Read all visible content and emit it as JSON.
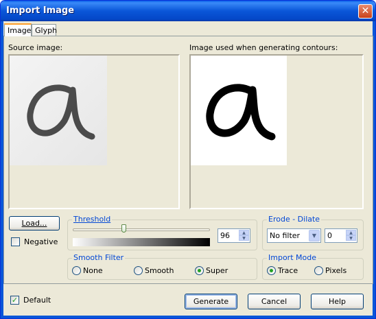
{
  "window": {
    "title": "Import Image",
    "close_glyph": "✕"
  },
  "tabs": [
    {
      "label": "Image",
      "active": true
    },
    {
      "label": "Glyph",
      "active": false
    }
  ],
  "source": {
    "label": "Source image:",
    "glyph": "a"
  },
  "contour": {
    "label": "Image used when generating contours:",
    "glyph": "a"
  },
  "load_button": "Load...",
  "negative": {
    "label": "Negative",
    "checked": false
  },
  "threshold": {
    "title": "Threshold",
    "value": "96",
    "slider_fraction": 0.37
  },
  "erode": {
    "title": "Erode - Dilate",
    "filter_value": "No filter",
    "spin_value": "0"
  },
  "smooth_filter": {
    "title": "Smooth Filter",
    "options": [
      {
        "label": "None",
        "selected": false
      },
      {
        "label": "Smooth",
        "selected": false
      },
      {
        "label": "Super",
        "selected": true
      }
    ]
  },
  "import_mode": {
    "title": "Import Mode",
    "options": [
      {
        "label": "Trace",
        "selected": true
      },
      {
        "label": "Pixels",
        "selected": false
      }
    ]
  },
  "default_check": {
    "label": "Default",
    "checked": true
  },
  "footer": {
    "generate": "Generate",
    "cancel": "Cancel",
    "help": "Help"
  },
  "colors": {
    "accent": "#0046d5",
    "titlebar": "#0a56d8",
    "check": "#21a121"
  }
}
